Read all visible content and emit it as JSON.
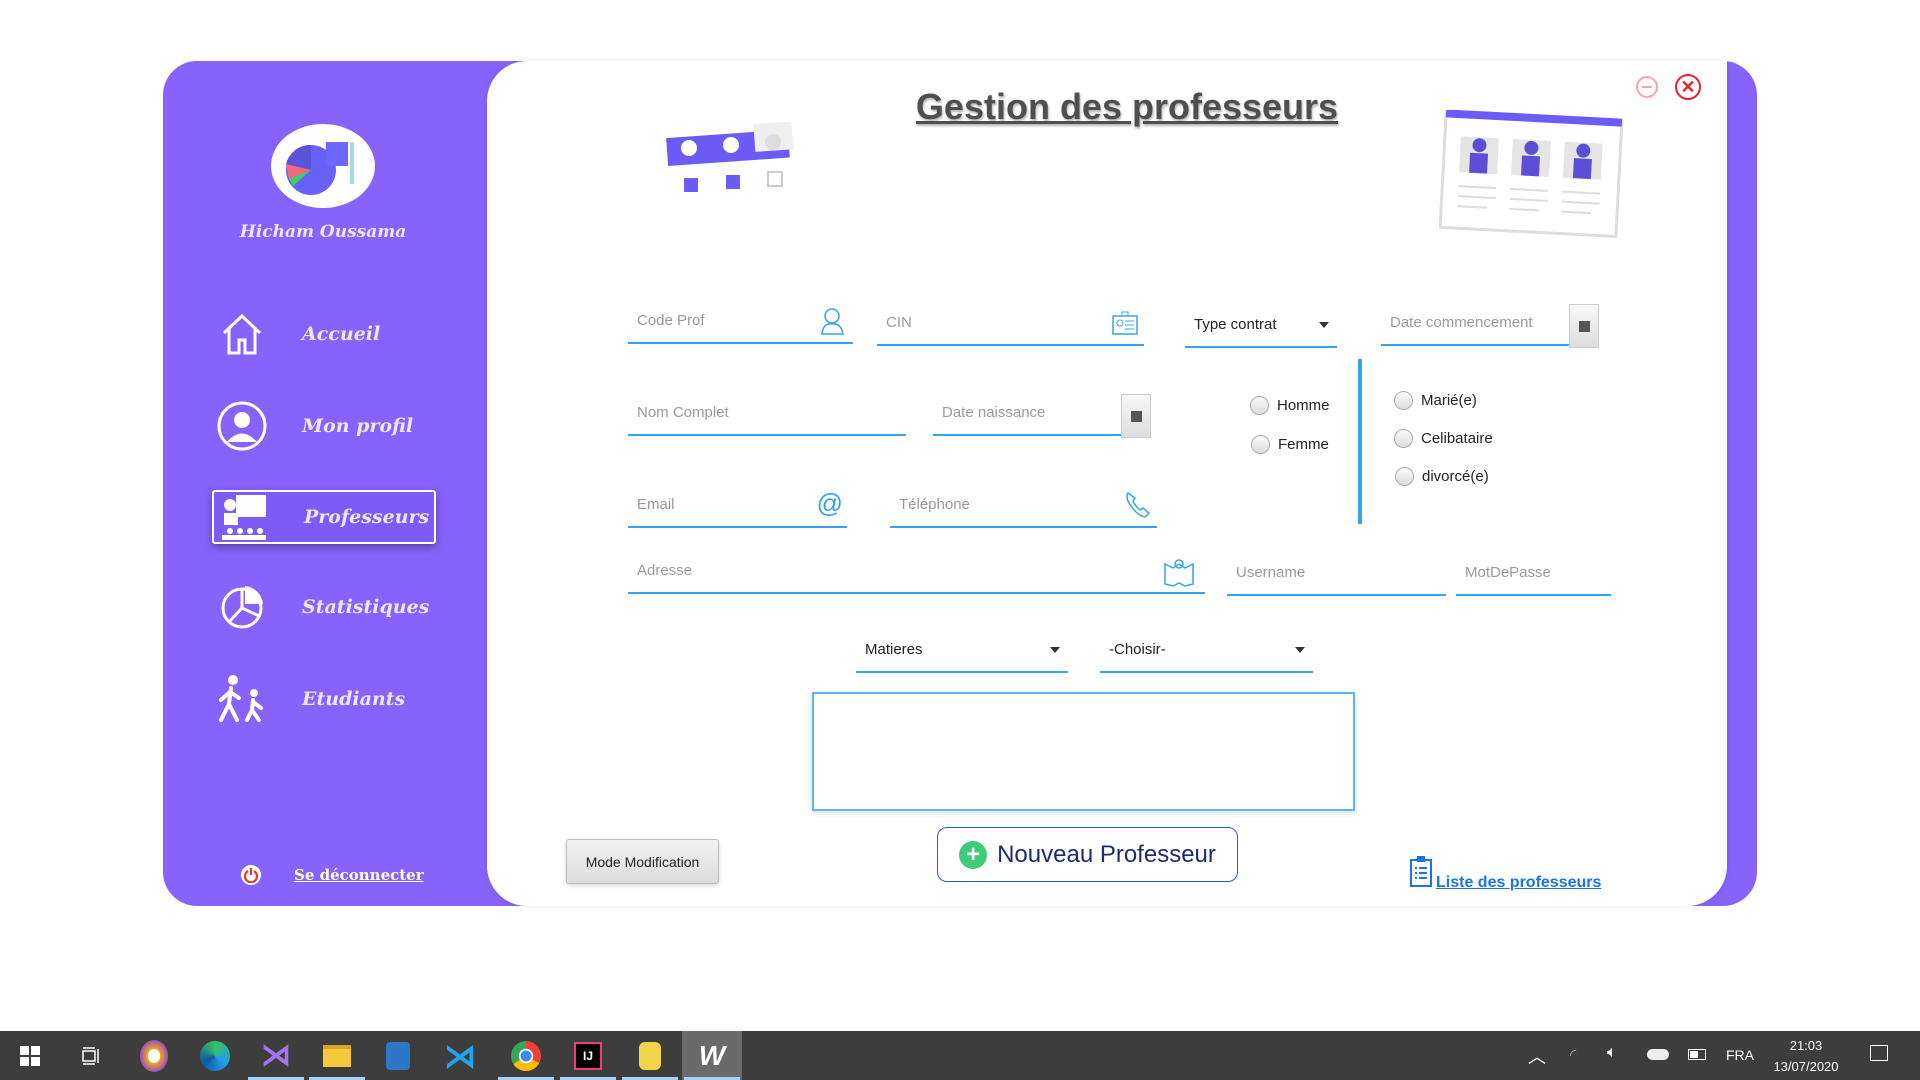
{
  "window": {
    "title": "Gestion des professeurs",
    "minimize_icon": "minimize-icon",
    "close_icon": "close-icon"
  },
  "sidebar": {
    "user_name": "Hicham Oussama",
    "items": [
      {
        "label": "Accueil",
        "icon": "home-icon"
      },
      {
        "label": "Mon profil",
        "icon": "user-icon"
      },
      {
        "label": "Professeurs",
        "icon": "teacher-icon",
        "active": true
      },
      {
        "label": "Statistiques",
        "icon": "pie-chart-icon"
      },
      {
        "label": "Etudiants",
        "icon": "students-icon"
      }
    ],
    "logout": "Se déconnecter"
  },
  "form": {
    "code_prof": "Code Prof",
    "cin": "CIN",
    "type_contrat": "Type contrat",
    "date_commencement": "Date commencement",
    "nom_complet": "Nom Complet",
    "date_naissance": "Date naissance",
    "email": "Email",
    "telephone": "Téléphone",
    "adresse": "Adresse",
    "username": "Username",
    "motdepasse": "MotDePasse",
    "gender": [
      "Homme",
      "Femme"
    ],
    "marital": [
      "Marié(e)",
      "Celibataire",
      "divorcé(e)"
    ],
    "matieres": "Matieres",
    "choisir": "-Choisir-"
  },
  "buttons": {
    "mode_modification": "Mode Modification",
    "nouveau_professeur": "Nouveau Professeur",
    "liste_professeurs": "Liste des professeurs"
  },
  "colors": {
    "sidebar": "#8763fb",
    "accent": "#35a4f0",
    "link": "#1a73e8"
  },
  "taskbar": {
    "apps": [
      "windows-start",
      "task-view",
      "avast-secure-browser",
      "edge",
      "visual-studio",
      "file-explorer",
      "azure-data-studio",
      "vscode",
      "chrome",
      "intellij",
      "sql-tool",
      "app-w"
    ],
    "language": "FRA",
    "time": "21:03",
    "date": "13/07/2020"
  }
}
